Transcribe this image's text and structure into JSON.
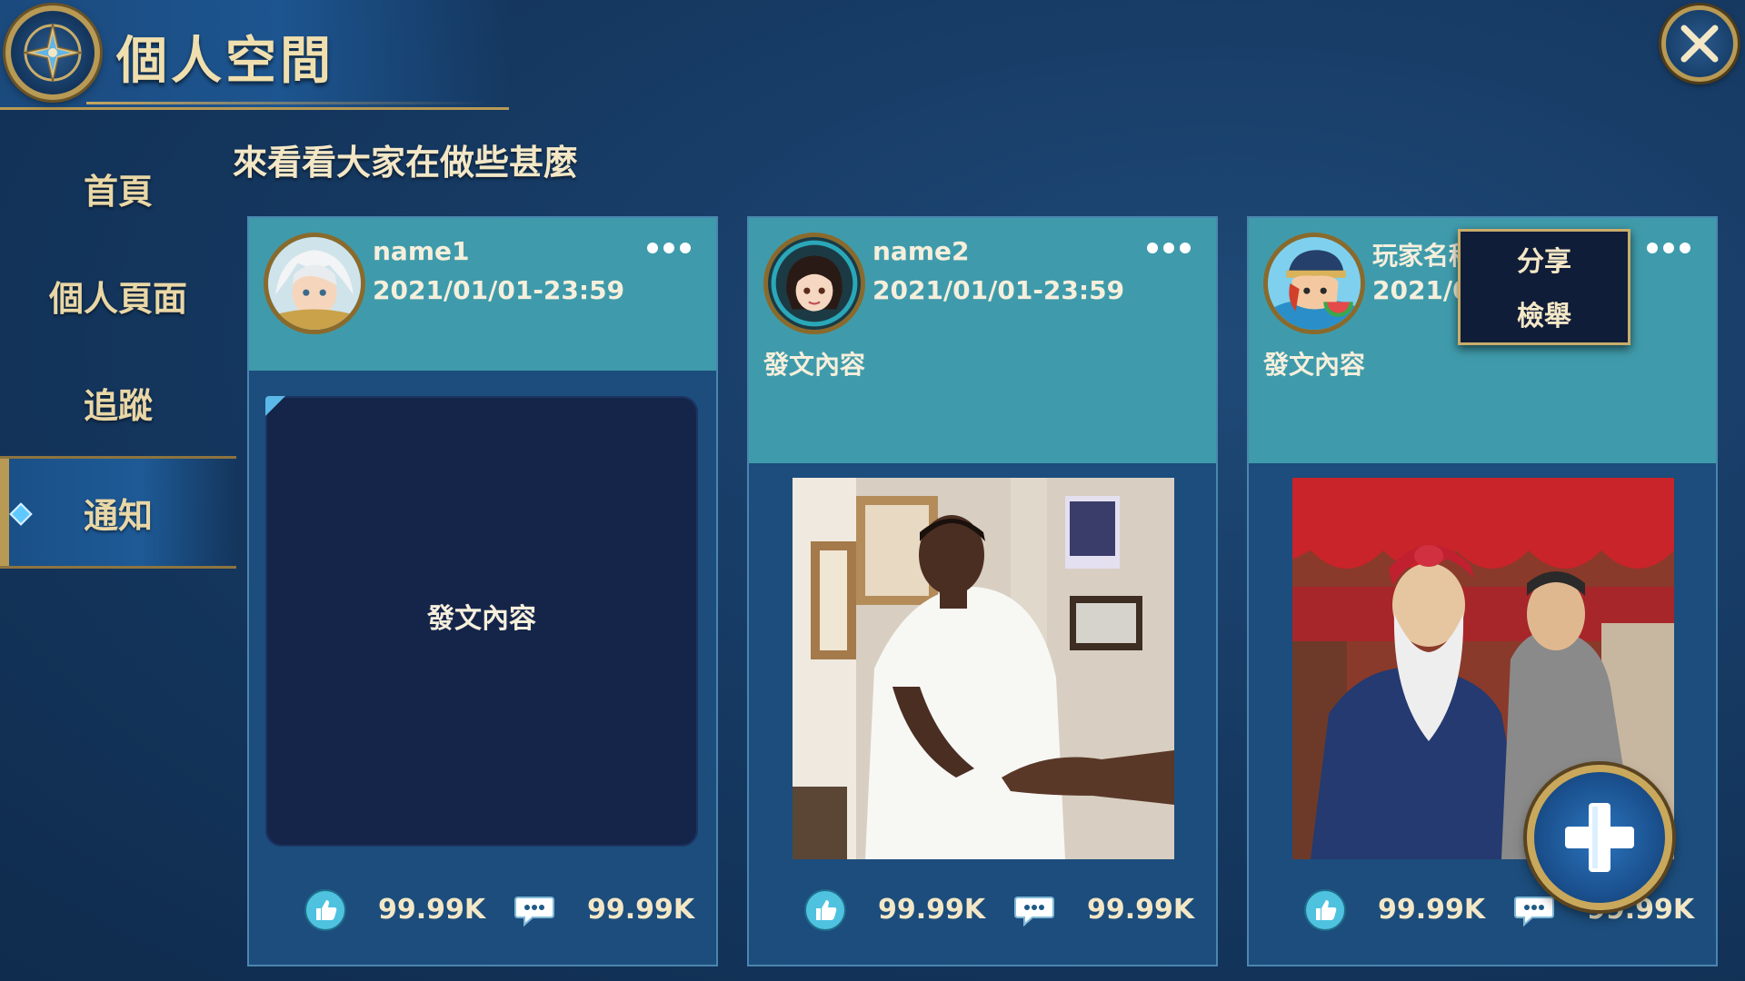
{
  "header": {
    "title": "個人空間"
  },
  "sidebar": {
    "items": [
      {
        "label": "首頁"
      },
      {
        "label": "個人頁面"
      },
      {
        "label": "追蹤"
      },
      {
        "label": "通知"
      }
    ]
  },
  "feed": {
    "title": "來看看大家在做些甚麼",
    "cards": [
      {
        "name": "name1",
        "date": "2021/01/01-23:59",
        "content": "發文內容",
        "likes": "99.99K",
        "comments": "99.99K"
      },
      {
        "name": "name2",
        "date": "2021/01/01-23:59",
        "content": "發文內容",
        "likes": "99.99K",
        "comments": "99.99K"
      },
      {
        "name": "玩家名稱",
        "date": "2021/01/01-23:59",
        "content": "發文內容",
        "likes": "99.99K",
        "comments": "99.99K"
      }
    ]
  },
  "popup_menu": {
    "share": "分享",
    "report": "檢舉"
  },
  "icons": {
    "close": "close-icon",
    "more": "more-icon",
    "like": "thumbs-up-icon",
    "comment": "comment-icon",
    "add": "plus-icon"
  },
  "colors": {
    "accent_gold": "#b89a55",
    "card_header": "#3f9bab",
    "card_body": "#1c4d7c"
  }
}
